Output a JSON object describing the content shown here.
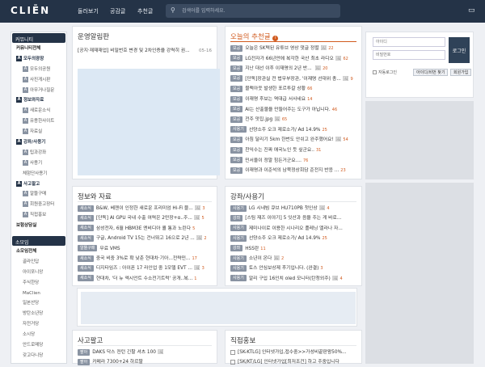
{
  "header": {
    "logo": "CLIĒN",
    "nav": [
      "둘러보기",
      "공감글",
      "추천글"
    ],
    "search_placeholder": "검색어를 입력하세요."
  },
  "sidebar": {
    "community_header": "커뮤니티",
    "community_items": [
      {
        "label": "커뮤니티전체",
        "style": "bold"
      },
      {
        "label": "모두의광장",
        "style": "cat",
        "icon": "A"
      },
      {
        "label": "모두의공원",
        "style": "sub",
        "icon": "A"
      },
      {
        "label": "사진게시판",
        "style": "sub",
        "icon": "A"
      },
      {
        "label": "아무거나질문",
        "style": "sub",
        "icon": "A"
      },
      {
        "label": "정보와자료",
        "style": "cat",
        "icon": "A"
      },
      {
        "label": "새로운소식",
        "style": "sub",
        "icon": "A"
      },
      {
        "label": "유용한사이트",
        "style": "sub",
        "icon": "A"
      },
      {
        "label": "자료실",
        "style": "sub",
        "icon": "A"
      },
      {
        "label": "강좌/사용기",
        "style": "cat",
        "icon": "A"
      },
      {
        "label": "팁과강좌",
        "style": "sub",
        "icon": "A"
      },
      {
        "label": "사용기",
        "style": "sub",
        "icon": "A"
      },
      {
        "label": "체험단사용기",
        "style": "subsub"
      },
      {
        "label": "사고팔고",
        "style": "cat",
        "icon": "A"
      },
      {
        "label": "알뜰구매",
        "style": "sub",
        "icon": "A"
      },
      {
        "label": "회원중고장터",
        "style": "sub",
        "icon": "A"
      },
      {
        "label": "직접홍보",
        "style": "sub",
        "icon": "A"
      },
      {
        "label": "보험상담실",
        "style": "bold"
      }
    ],
    "somoim_header": "소모임",
    "somoim_items": [
      {
        "label": "소모임전체",
        "style": "bold"
      },
      {
        "label": "골라인답",
        "style": "subsub"
      },
      {
        "label": "아이포니앙",
        "style": "subsub"
      },
      {
        "label": "주식한당",
        "style": "subsub"
      },
      {
        "label": "MaClien",
        "style": "subsub"
      },
      {
        "label": "일본산당",
        "style": "subsub"
      },
      {
        "label": "방탄소년당",
        "style": "subsub"
      },
      {
        "label": "자전거당",
        "style": "subsub"
      },
      {
        "label": "소시당",
        "style": "subsub"
      },
      {
        "label": "안드로메당",
        "style": "subsub"
      },
      {
        "label": "갖고다니당",
        "style": "subsub"
      }
    ]
  },
  "notice": {
    "title": "운영알림판",
    "items": [
      {
        "text": "[공지·재재재업] 비밀번호 변경 및 2차인증을 강력히 권...",
        "date": "05-16"
      }
    ]
  },
  "recommend": {
    "title": "오늘의 추천글",
    "info_icon": "i",
    "items": [
      {
        "tag": "모공",
        "text": "오늘은 SK텍된 유튜브 영상 댓글 정렬",
        "img": "🖼",
        "count": "22"
      },
      {
        "tag": "모공",
        "text": "LG전자가 66년만에 복각한 국산 최초 라디오",
        "img": "🖼",
        "count": "62"
      },
      {
        "tag": "모공",
        "text": "지난 대선 이후 이재명의 2년 반... ",
        "img": "🖼",
        "count": "20"
      },
      {
        "tag": "모공",
        "text": "[단독]장관실 전 법무부장관, '이재명 선대위 총...",
        "img": "🖼",
        "count": "9"
      },
      {
        "tag": "모공",
        "text": "블랙아웃 발생한 포르투갈 상황",
        "img": "",
        "count": "66"
      },
      {
        "tag": "모공",
        "text": "이재명 후보는 역대급 서사네요",
        "img": "",
        "count": "14"
      },
      {
        "tag": "모공",
        "text": "AI는 산출물을 만들어주는 도구가 아닙니다.",
        "img": "",
        "count": "46"
      },
      {
        "tag": "모공",
        "text": "전주 맛집.jpg",
        "img": "🖼",
        "count": "65"
      },
      {
        "tag": "사용기",
        "text": "선양소주 오크 제로소가/ Ad 14.9%",
        "img": "",
        "count": "25"
      },
      {
        "tag": "모공",
        "text": "아침 달리기 5km 한번도 안쉬고 완주했어요!",
        "img": "🖼",
        "count": "54"
      },
      {
        "tag": "모공",
        "text": "찬익수는 진짜 애국노인 듯 싶군요..",
        "img": "",
        "count": "31"
      },
      {
        "tag": "모공",
        "text": "민서울이 정말 힘든거군요....",
        "img": "",
        "count": "76"
      },
      {
        "tag": "모공",
        "text": "이재명과 이준석의 남북정상회담 준전지 반응 ...",
        "img": "",
        "count": "23"
      }
    ]
  },
  "info": {
    "title": "정보와 자료",
    "items": [
      {
        "tag": "새소식",
        "text": "B&W, 베젠이 인정한 새로운 프리미엄 Hi-Fi 블...",
        "img": "🖼",
        "count": "3"
      },
      {
        "tag": "새소식",
        "text": "[단독] AI GPU 국내 수출 여력은 2만장+α..주...",
        "img": "🖼",
        "count": "5"
      },
      {
        "tag": "새소식",
        "text": "삼성전자, 6월 HBM3E 엔비디아 퀄 통과 노린다",
        "img": "",
        "count": "5"
      },
      {
        "tag": "새소식",
        "text": "구글, Android TV 15는 건너뛰고 16으로 2년 ...",
        "img": "🖼",
        "count": "2"
      },
      {
        "tag": "알뜰구매",
        "text": "무료 VMS",
        "img": "",
        "count": ""
      },
      {
        "tag": "새소식",
        "text": "중국 비중 3%로 확 낮춘 현대차·기아...전략민...",
        "img": "",
        "count": "17"
      },
      {
        "tag": "새소식",
        "text": "디지타임즈 : 아이폰 17 라인업 중 1모델 EVT ...",
        "img": "🖼",
        "count": "3"
      },
      {
        "tag": "새소식",
        "text": "현대차, '더 뉴 엑시언트 수소전기트럭' 공개..복...",
        "img": "",
        "count": "1"
      }
    ]
  },
  "lecture": {
    "title": "강좌/사용기",
    "items": [
      {
        "tag": "사용기",
        "text": "LG 시네빔 큐브 HU710PB 첫인상",
        "img": "🖼",
        "count": "4"
      },
      {
        "tag": "강좌",
        "text": "[스팀 재즈 이야기] 5 잇산과 음을 주는 게 바로...",
        "img": "",
        "count": ""
      },
      {
        "tag": "사용기",
        "text": "제미나이로 이용한 시나리오 플레닝 엘라나 자...",
        "img": "",
        "count": ""
      },
      {
        "tag": "사용기",
        "text": "선양소주 오크 제로소가/ Ad 14.9%",
        "img": "",
        "count": "25"
      },
      {
        "tag": "강좌",
        "text": "HSS란",
        "img": "",
        "count": "11"
      },
      {
        "tag": "사용기",
        "text": "소년이 온다",
        "img": "🖼",
        "count": "2"
      },
      {
        "tag": "사용기",
        "text": "토스 안심보상제 후기입니다. (완결)",
        "img": "",
        "count": "3"
      },
      {
        "tag": "사용기",
        "text": "알리 구입 16인치 oled 모니터(탄청외주)",
        "img": "🖼",
        "count": "4"
      }
    ]
  },
  "sell": {
    "title": "사고팔고",
    "items": [
      {
        "tag": "팔아",
        "text": "DAKS 닥스 컨턴 긴팔 셔츠 100",
        "img": "🖼",
        "count": ""
      },
      {
        "tag": "팔아",
        "text": "카메라 7300+24 하르팔"
      }
    ]
  },
  "promo": {
    "title": "직접홍보",
    "items": [
      {
        "text": "[SK-KTLG] 인터넷가입,접수중>>가성비끝판왕50%..."
      },
      {
        "text": "[SK/KT/LG] 인터넷가입[최저조건] 하고 주중입니다"
      }
    ]
  },
  "login": {
    "id_placeholder": "아이디",
    "pw_placeholder": "비밀번호",
    "login_button": "로그인",
    "auto_login": "자동로그인",
    "find_button": "아이디/비번 찾기",
    "join_button": "회원가입"
  },
  "colors": {
    "navy": "#243347",
    "accent": "#d15b1f",
    "tag": "#8993a2"
  }
}
